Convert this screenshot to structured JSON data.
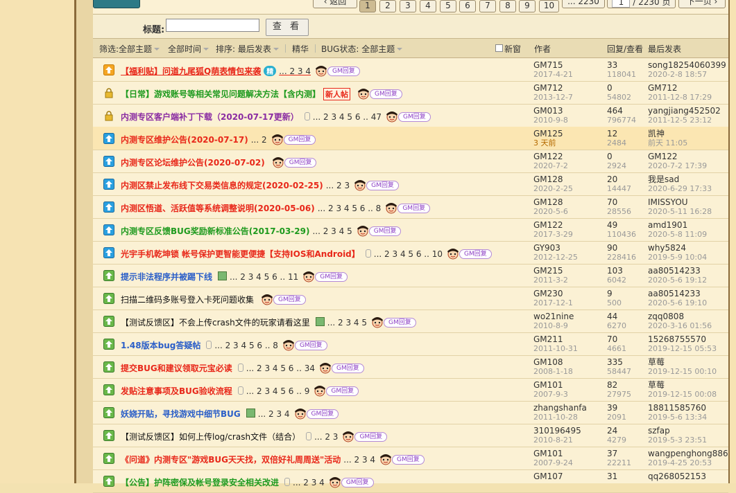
{
  "pager": {
    "back_label": "‹ 返回",
    "pages": [
      "1",
      "2",
      "3",
      "4",
      "5",
      "6",
      "7",
      "8",
      "9",
      "10"
    ],
    "current": "1",
    "ellipsis": "... 2230",
    "page_input": "1",
    "total": "/ 2230 页",
    "next_label": "下一页 ›"
  },
  "search": {
    "label": "标题:",
    "value": "",
    "button": "查 看"
  },
  "filters": {
    "filter_label": "筛选:",
    "filter_value": "全部主题",
    "time_value": "全部时间",
    "sort_label": "排序:",
    "sort_value": "最后发表",
    "digest": "精华",
    "bug_label": "BUG状态:",
    "bug_value": "全部主题",
    "new_window": "新窗",
    "col_author": "作者",
    "col_reply": "回复/查看",
    "col_last": "最后发表"
  },
  "threads": [
    {
      "title": "【福利贴】问道九尾狐Q萌表情包来袭",
      "color": "red",
      "pages": "... 2 3 4",
      "badge": "精",
      "author": "GM715",
      "date": "2017-4-21",
      "replies": "33",
      "views": "118041",
      "last_user": "song18254060399",
      "last_time": "2020-2-8 18:57"
    },
    {
      "title": "【日常】游戏账号等相关常见问题解决方法【含内测】",
      "color": "green",
      "pages": "",
      "badge_new": "新人帖",
      "author": "GM712",
      "date": "2013-12-7",
      "replies": "0",
      "views": "54802",
      "last_user": "GM712",
      "last_time": "2011-12-8 17:29"
    },
    {
      "title": "内测专区客户端补丁下载（2020-07-17更新）",
      "color": "purple",
      "pages": "... 2 3 4 5 6 .. 47",
      "author": "GM013",
      "date": "2010-9-8",
      "replies": "464",
      "views": "796774",
      "last_user": "yangjiang452502",
      "last_time": "2011-12-5 23:12"
    },
    {
      "title": "内测专区维护公告(2020-07-17)",
      "color": "red",
      "pages": "... 2",
      "author": "GM125",
      "date": "3 天前",
      "replies": "12",
      "views": "2484",
      "last_user": "凯神",
      "last_time": "前天 11:05"
    },
    {
      "title": "内测专区论坛维护公告(2020-07-02)",
      "color": "red",
      "pages": "",
      "author": "GM122",
      "date": "2020-7-2",
      "replies": "0",
      "views": "2924",
      "last_user": "GM122",
      "last_time": "2020-7-2 17:39"
    },
    {
      "title": "内测区禁止发布线下交易类信息的规定(2020-02-25)",
      "color": "red",
      "pages": "... 2 3",
      "author": "GM128",
      "date": "2020-2-25",
      "replies": "20",
      "views": "14447",
      "last_user": "我是sad",
      "last_time": "2020-6-29 17:33"
    },
    {
      "title": "内测区悟道、活跃值等系统调整说明(2020-05-06)",
      "color": "red",
      "pages": "... 2 3 4 5 6 .. 8",
      "author": "GM128",
      "date": "2020-5-6",
      "replies": "70",
      "views": "28556",
      "last_user": "IMISSYOU",
      "last_time": "2020-5-11 16:28"
    },
    {
      "title": "内测专区反馈BUG奖励新标准公告(2017-03-29)",
      "color": "green",
      "pages": "... 2 3 4 5",
      "author": "GM122",
      "date": "2017-3-29",
      "replies": "49",
      "views": "110436",
      "last_user": "amd1901",
      "last_time": "2020-5-8 11:09"
    },
    {
      "title": "光宇手机乾坤锁 帐号保护更智能更便捷【支持IOS和Android】",
      "color": "red",
      "pages": "... 2 3 4 5 6 .. 10",
      "author": "GY903",
      "date": "2012-12-25",
      "replies": "90",
      "views": "228416",
      "last_user": "why5824",
      "last_time": "2019-5-9 10:04"
    },
    {
      "title": "提示非法程序并被踢下线",
      "color": "blue",
      "pages": "... 2 3 4 5 6 .. 11",
      "author": "GM215",
      "date": "2011-3-2",
      "replies": "103",
      "views": "6042",
      "last_user": "aa80514233",
      "last_time": "2020-5-6 19:12"
    },
    {
      "title": "扫描二维码多账号登入卡死问题收集",
      "color": "black",
      "pages": "",
      "author": "GM230",
      "date": "2017-12-1",
      "replies": "9",
      "views": "500",
      "last_user": "aa80514233",
      "last_time": "2020-5-6 19:10"
    },
    {
      "title": "【测试反馈区】不会上传crash文件的玩家请看这里",
      "color": "black",
      "pages": "... 2 3 4 5",
      "author": "wo21nine",
      "date": "2010-8-9",
      "replies": "44",
      "views": "6270",
      "last_user": "zqq0808",
      "last_time": "2020-3-16 01:56"
    },
    {
      "title": "1.48版本bug答疑帖",
      "color": "blue",
      "pages": "... 2 3 4 5 6 .. 8",
      "author": "GM211",
      "date": "2011-10-31",
      "replies": "70",
      "views": "4661",
      "last_user": "15268755570",
      "last_time": "2019-12-15 05:53"
    },
    {
      "title": "提交BUG和建议领取元宝必读",
      "color": "red",
      "pages": "... 2 3 4 5 6 .. 34",
      "author": "GM108",
      "date": "2008-1-18",
      "replies": "335",
      "views": "58447",
      "last_user": "草莓",
      "last_time": "2019-12-15 00:10"
    },
    {
      "title": "发贴注意事项及BUG验收流程",
      "color": "red",
      "pages": "... 2 3 4 5 6 .. 9",
      "author": "GM101",
      "date": "2007-9-3",
      "replies": "82",
      "views": "27975",
      "last_user": "草莓",
      "last_time": "2019-12-15 00:08"
    },
    {
      "title": "妖娆开贴，寻找游戏中细节BUG",
      "color": "blue",
      "pages": "... 2 3 4",
      "author": "zhangshanfa",
      "date": "2011-10-28",
      "replies": "39",
      "views": "2091",
      "last_user": "18811585760",
      "last_time": "2019-5-6 13:34"
    },
    {
      "title": "【测试反馈区】如何上传log/crash文件（结合）",
      "color": "black",
      "pages": "... 2 3",
      "author": "310196495",
      "date": "2010-8-21",
      "replies": "24",
      "views": "4279",
      "last_user": "szfap",
      "last_time": "2019-5-3 23:51"
    },
    {
      "title": "《问道》内测专区\"游戏BUG天天找，双倍好礼周周送\"活动",
      "color": "red",
      "pages": "... 2 3 4",
      "author": "GM101",
      "date": "2007-9-24",
      "replies": "37",
      "views": "22211",
      "last_user": "wangpenghong886",
      "last_time": "2019-4-25 20:53"
    },
    {
      "title": "【公告】护阵密保及帐号登录安全相关改进",
      "color": "green",
      "pages": "... 2 3 4",
      "author": "GM107",
      "date": "",
      "replies": "31",
      "views": "",
      "last_user": "qq268052153",
      "last_time": ""
    }
  ],
  "gm_label": "GM回复",
  "colors": {
    "background": "#f3e2b1",
    "header": "#e9dcb4",
    "highlight": "#fbe6b2"
  }
}
